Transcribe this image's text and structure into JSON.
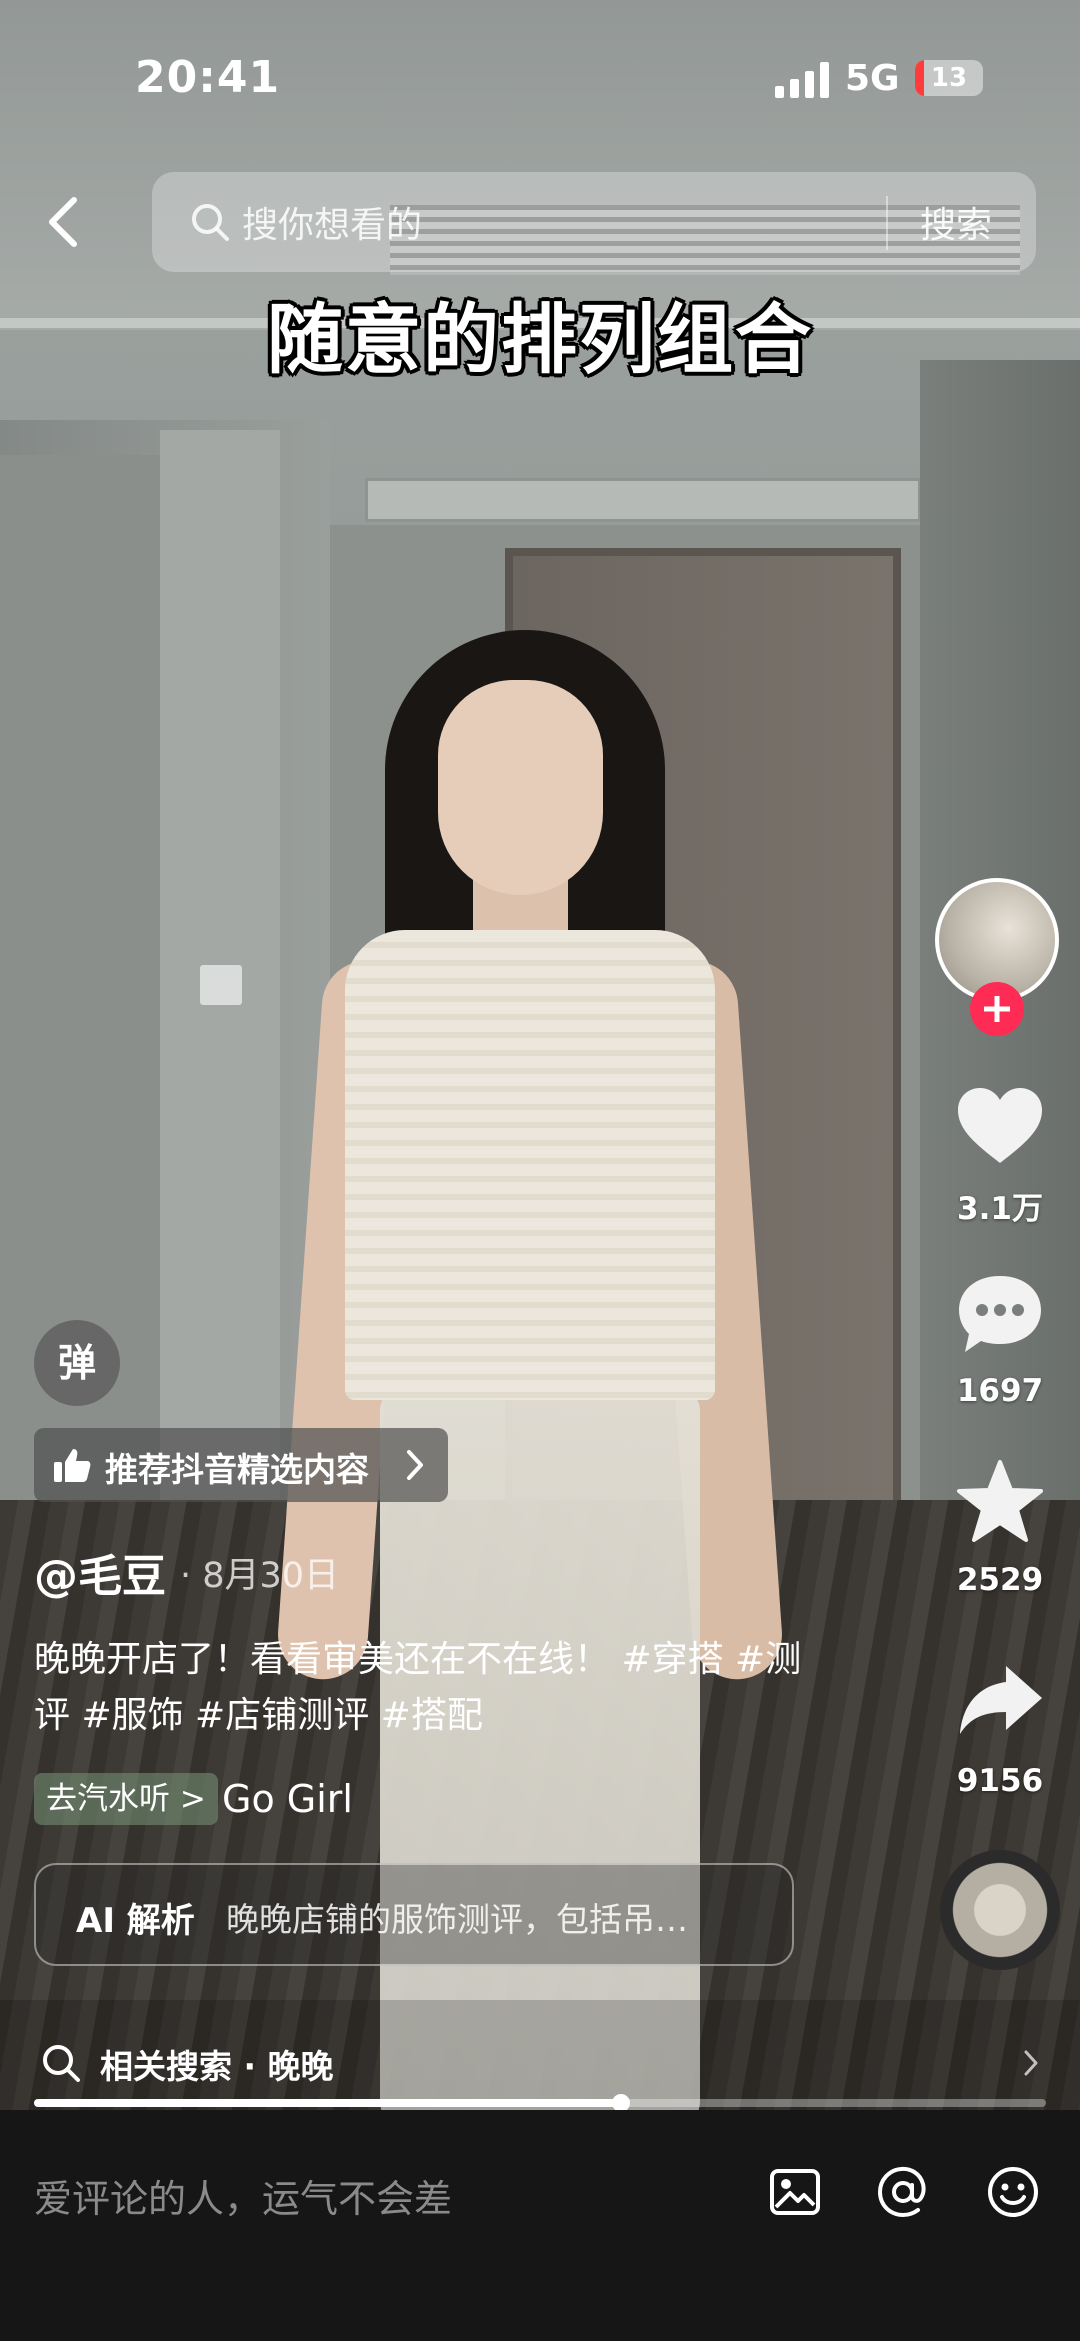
{
  "status_bar": {
    "time": "20:41",
    "network": "5G",
    "battery": "13",
    "battery_level": 0.13
  },
  "search": {
    "placeholder": "搜你想看的",
    "action_label": "搜索"
  },
  "video": {
    "caption": "随意的排列组合",
    "progress": 0.58
  },
  "right_rail": {
    "likes": "3.1万",
    "comments": "1697",
    "favorites": "2529",
    "shares": "9156"
  },
  "overlay": {
    "danmu_label": "弹",
    "recommend_label": "推荐抖音精选内容",
    "author": "@毛豆",
    "date": "· 8月30日",
    "description": "晚晚开店了！看看审美还在不在线！ #穿搭 #测评 #服饰 #店铺测评 #搭配",
    "music_tag": "去汽水听 >",
    "music_title": "Go Girl",
    "ai_label": "AI 解析",
    "ai_summary": "晚晚店铺的服饰测评，包括吊…",
    "related_search": "相关搜索 · 晚晚"
  },
  "comment_bar": {
    "placeholder": "爱评论的人，运气不会差"
  },
  "colors": {
    "accent": "#fe2c55",
    "comment_bar_bg": "#161616"
  },
  "icons": [
    "chevron-left-icon",
    "search-icon",
    "heart-icon",
    "comment-icon",
    "star-icon",
    "share-icon",
    "thumbs-up-icon",
    "image-icon",
    "at-icon",
    "emoji-icon"
  ]
}
